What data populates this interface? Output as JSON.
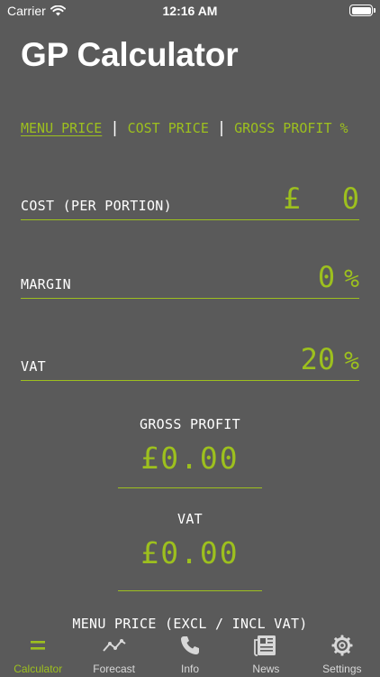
{
  "status": {
    "carrier": "Carrier",
    "time": "12:16 AM"
  },
  "title": "GP Calculator",
  "modes": [
    {
      "label": "MENU PRICE",
      "active": true
    },
    {
      "label": "COST PRICE",
      "active": false
    },
    {
      "label": "GROSS PROFIT %",
      "active": false
    }
  ],
  "mode_separator": "|",
  "fields": {
    "cost": {
      "label": "COST (PER PORTION)",
      "currency": "£",
      "value": "0"
    },
    "margin": {
      "label": "MARGIN",
      "value": "0",
      "unit": "%"
    },
    "vat": {
      "label": "VAT",
      "value": "20",
      "unit": "%"
    }
  },
  "results": {
    "gross_profit": {
      "label": "GROSS PROFIT",
      "value": "£0.00"
    },
    "vat": {
      "label": "VAT",
      "value": "£0.00"
    },
    "menu_price": {
      "label": "MENU PRICE (EXCL / INCL VAT)"
    }
  },
  "tabs": [
    {
      "label": "Calculator",
      "icon": "equals-icon",
      "active": true
    },
    {
      "label": "Forecast",
      "icon": "chart-line-icon",
      "active": false
    },
    {
      "label": "Info",
      "icon": "phone-icon",
      "active": false
    },
    {
      "label": "News",
      "icon": "newspaper-icon",
      "active": false
    },
    {
      "label": "Settings",
      "icon": "gear-icon",
      "active": false
    }
  ],
  "colors": {
    "background": "#5a5a5a",
    "accent": "#9dc01e",
    "text": "#ffffff"
  }
}
